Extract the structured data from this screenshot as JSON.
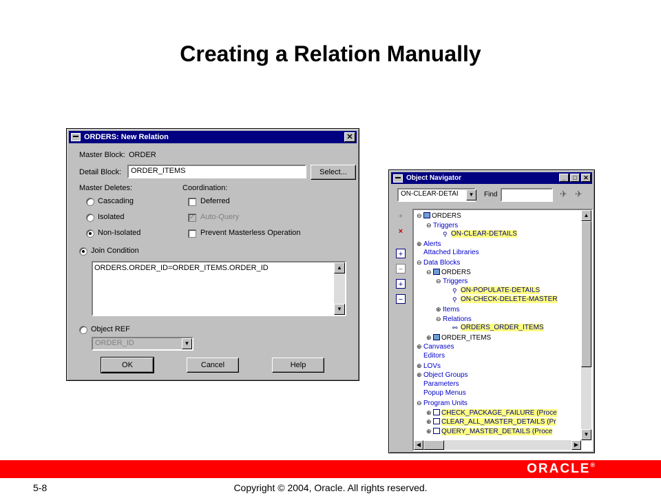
{
  "slide": {
    "title": "Creating a Relation Manually",
    "number": "5-8",
    "copyright": "Copyright © 2004, Oracle.  All rights reserved.",
    "logo": "ORACLE",
    "logo_mark": "®",
    "brand_color": "#ff0000"
  },
  "dialog": {
    "title": "ORDERS: New Relation",
    "close": "✕",
    "master_block_label": "Master Block:",
    "master_block_value": "ORDER",
    "detail_block_label": "Detail Block:",
    "detail_block_value": "ORDER_ITEMS",
    "select_button": "Select...",
    "master_deletes_label": "Master Deletes:",
    "master_deletes_options": [
      "Cascading",
      "Isolated",
      "Non-Isolated"
    ],
    "master_deletes_selected": "Non-Isolated",
    "coordination_label": "Coordination:",
    "coordination_options": [
      {
        "label": "Deferred",
        "checked": false,
        "enabled": true
      },
      {
        "label": "Auto-Query",
        "checked": true,
        "enabled": false
      },
      {
        "label": "Prevent Masterless Operation",
        "checked": false,
        "enabled": true
      }
    ],
    "join_condition_label": "Join Condition",
    "join_condition_value": "ORDERS.ORDER_ID=ORDER_ITEMS.ORDER_ID",
    "object_ref_label": "Object REF",
    "object_ref_value": "ORDER_ID",
    "ok_button": "OK",
    "cancel_button": "Cancel",
    "help_button": "Help"
  },
  "navigator": {
    "title": "Object Navigator",
    "search_value": "ON-CLEAR-DETAI",
    "find_label": "Find",
    "tree": [
      {
        "label": "ORDERS",
        "level": 0,
        "exp": "⊖",
        "icon": "form-icon",
        "dark": true,
        "hl": false
      },
      {
        "label": "Triggers",
        "level": 1,
        "exp": "⊖",
        "icon": "",
        "dark": false,
        "hl": false
      },
      {
        "label": "ON-CLEAR-DETAILS",
        "level": 2,
        "exp": "",
        "icon": "trigger-icon",
        "dark": false,
        "hl": true
      },
      {
        "label": "Alerts",
        "level": 0,
        "exp": "⊕",
        "icon": "",
        "dark": false,
        "hl": false
      },
      {
        "label": "Attached Libraries",
        "level": 0,
        "exp": "",
        "icon": "",
        "dark": false,
        "hl": false
      },
      {
        "label": "Data Blocks",
        "level": 0,
        "exp": "⊖",
        "icon": "",
        "dark": false,
        "hl": false
      },
      {
        "label": "ORDERS",
        "level": 1,
        "exp": "⊖",
        "icon": "block-icon",
        "dark": true,
        "hl": false
      },
      {
        "label": "Triggers",
        "level": 2,
        "exp": "⊖",
        "icon": "",
        "dark": false,
        "hl": false
      },
      {
        "label": "ON-POPULATE-DETAILS",
        "level": 3,
        "exp": "",
        "icon": "trigger-icon",
        "dark": false,
        "hl": true
      },
      {
        "label": "ON-CHECK-DELETE-MASTER",
        "level": 3,
        "exp": "",
        "icon": "trigger-icon",
        "dark": false,
        "hl": true
      },
      {
        "label": "Items",
        "level": 2,
        "exp": "⊕",
        "icon": "",
        "dark": false,
        "hl": false
      },
      {
        "label": "Relations",
        "level": 2,
        "exp": "⊖",
        "icon": "",
        "dark": false,
        "hl": false
      },
      {
        "label": "ORDERS_ORDER_ITEMS",
        "level": 3,
        "exp": "",
        "icon": "relation-icon",
        "dark": false,
        "hl": true
      },
      {
        "label": "ORDER_ITEMS",
        "level": 1,
        "exp": "⊕",
        "icon": "block-icon",
        "dark": true,
        "hl": false
      },
      {
        "label": "Canvases",
        "level": 0,
        "exp": "⊕",
        "icon": "",
        "dark": false,
        "hl": false
      },
      {
        "label": "Editors",
        "level": 0,
        "exp": "",
        "icon": "",
        "dark": false,
        "hl": false
      },
      {
        "label": "LOVs",
        "level": 0,
        "exp": "⊕",
        "icon": "",
        "dark": false,
        "hl": false
      },
      {
        "label": "Object Groups",
        "level": 0,
        "exp": "⊕",
        "icon": "",
        "dark": false,
        "hl": false
      },
      {
        "label": "Parameters",
        "level": 0,
        "exp": "",
        "icon": "",
        "dark": false,
        "hl": false
      },
      {
        "label": "Popup Menus",
        "level": 0,
        "exp": "",
        "icon": "",
        "dark": false,
        "hl": false
      },
      {
        "label": "Program Units",
        "level": 0,
        "exp": "⊖",
        "icon": "",
        "dark": false,
        "hl": false
      },
      {
        "label": "CHECK_PACKAGE_FAILURE (Proce",
        "level": 1,
        "exp": "⊕",
        "icon": "program-unit-icon",
        "dark": false,
        "hl": true
      },
      {
        "label": "CLEAR_ALL_MASTER_DETAILS (Pr",
        "level": 1,
        "exp": "⊕",
        "icon": "program-unit-icon",
        "dark": false,
        "hl": true
      },
      {
        "label": "QUERY_MASTER_DETAILS (Proce",
        "level": 1,
        "exp": "⊕",
        "icon": "program-unit-icon",
        "dark": false,
        "hl": true
      }
    ]
  }
}
